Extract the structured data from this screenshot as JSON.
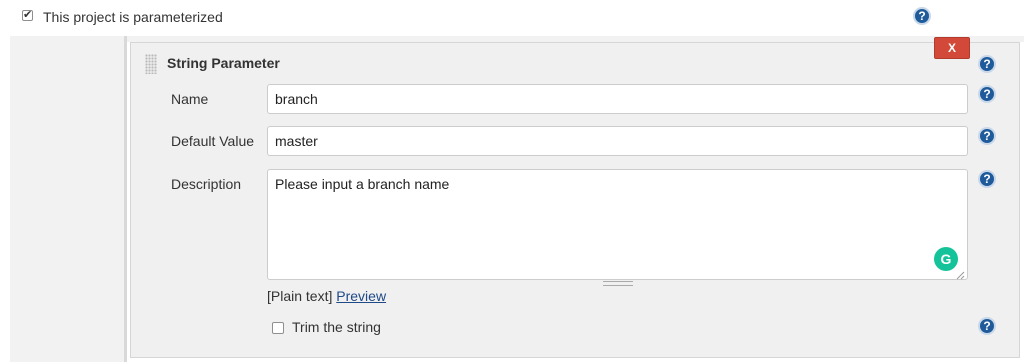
{
  "parameterized": {
    "checkbox_label": "This project is parameterized",
    "checked": true
  },
  "parameter_block": {
    "title": "String Parameter",
    "delete_label": "X",
    "name_label": "Name",
    "name_value": "branch",
    "default_label": "Default Value",
    "default_value": "master",
    "description_label": "Description",
    "description_value": "Please input a branch name",
    "format_text": "[Plain text]",
    "preview_link": "Preview",
    "trim_label": "Trim the string",
    "trim_checked": false
  },
  "help_icon_glyph": "?",
  "grammarly_glyph": "G",
  "colors": {
    "delete_button": "#d24939",
    "help_icon": "#1f5b9a",
    "grammarly": "#15c39a",
    "link": "#204a87"
  }
}
